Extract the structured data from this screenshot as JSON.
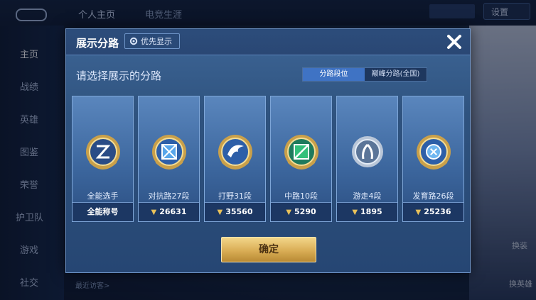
{
  "background": {
    "top_tabs": [
      "个人主页",
      "电竞生涯"
    ],
    "settings_label": "设置",
    "sidebar": [
      "主页",
      "战绩",
      "英雄",
      "图鉴",
      "荣誉",
      "护卫队",
      "游戏",
      "社交"
    ],
    "right_buttons": [
      "换装",
      "换英雄"
    ],
    "recent_visitors_label": "最近访客>"
  },
  "modal": {
    "title": "展示分路",
    "priority_button": "优先显示",
    "subtitle": "请选择展示的分路",
    "toggle": {
      "option_a": "分路段位",
      "option_b": "巅峰分路(全国)"
    },
    "cards": [
      {
        "role": "全能选手",
        "stat": "全能称号",
        "has_arrow": false,
        "icon": "all-round-emblem"
      },
      {
        "role": "对抗路27段",
        "stat": "26631",
        "has_arrow": true,
        "icon": "clash-lane-emblem"
      },
      {
        "role": "打野31段",
        "stat": "35560",
        "has_arrow": true,
        "icon": "jungle-emblem"
      },
      {
        "role": "中路10段",
        "stat": "5290",
        "has_arrow": true,
        "icon": "mid-lane-emblem"
      },
      {
        "role": "游走4段",
        "stat": "1895",
        "has_arrow": true,
        "icon": "roam-emblem"
      },
      {
        "role": "发育路26段",
        "stat": "25236",
        "has_arrow": true,
        "icon": "farm-lane-emblem"
      }
    ],
    "confirm_button": "确定"
  }
}
